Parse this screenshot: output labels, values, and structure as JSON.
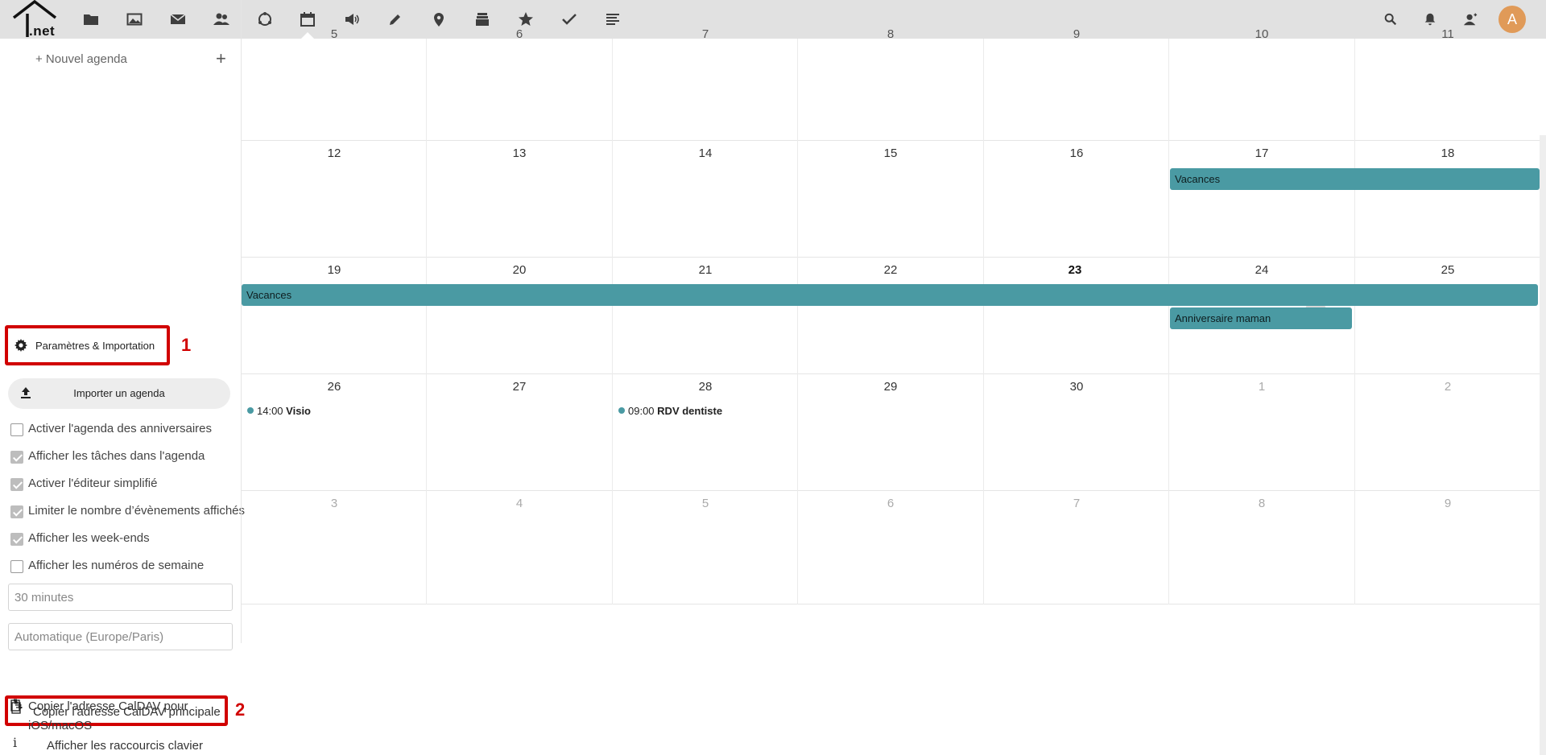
{
  "topbar": {
    "logo_text": ".net",
    "apps": [
      "files-icon",
      "photos-icon",
      "mail-icon",
      "contacts-icon",
      "activity-icon",
      "calendar-icon",
      "announcements-icon",
      "notes-icon",
      "maps-icon",
      "deck-icon",
      "bookmarks-icon",
      "tasks-icon",
      "news-icon"
    ],
    "active_app": "calendar-icon",
    "right_icons": [
      "search-icon",
      "notifications-icon",
      "contacts-menu-icon"
    ],
    "avatar_initial": "A"
  },
  "sidebar": {
    "new_calendar": "+ Nouvel agenda",
    "new_calendar_plus": "+",
    "settings_label": "Paramètres & Importation",
    "import_label": "Importer un agenda",
    "checkboxes": [
      {
        "label": "Activer l'agenda des anniversaires",
        "checked": false
      },
      {
        "label": "Afficher les tâches dans l'agenda",
        "checked": true
      },
      {
        "label": "Activer l'éditeur simplifié",
        "checked": true
      },
      {
        "label": "Limiter le nombre d’évènements affichés",
        "checked": true
      },
      {
        "label": "Afficher les week-ends",
        "checked": true
      },
      {
        "label": "Afficher les numéros de semaine",
        "checked": false
      }
    ],
    "slot_duration": "30 minutes",
    "timezone": "Automatique (Europe/Paris)",
    "copy_main": "Copier l'adresse CalDAV principale",
    "copy_ios_line1": "Copier l'adresse CalDAV pour",
    "copy_ios_line2": "iOS/macOS",
    "keyboard_shortcuts": "Afficher les raccourcis clavier",
    "info_glyph": "i"
  },
  "annotations": {
    "marker_1": "1",
    "marker_2": "2"
  },
  "calendar": {
    "weeks": [
      [
        "5",
        "6",
        "7",
        "8",
        "9",
        "10",
        "11"
      ],
      [
        "12",
        "13",
        "14",
        "15",
        "16",
        "17",
        "18"
      ],
      [
        "19",
        "20",
        "21",
        "22",
        "23",
        "24",
        "25"
      ],
      [
        "26",
        "27",
        "28",
        "29",
        "30",
        "1",
        "2"
      ],
      [
        "3",
        "4",
        "5",
        "6",
        "7",
        "8",
        "9"
      ]
    ],
    "today": "23",
    "events": {
      "vacances_1": "Vacances",
      "vacances_2": "Vacances",
      "anniversaire": "Anniversaire maman",
      "visio_time": "14:00",
      "visio_title": "Visio",
      "dentiste_time": "09:00",
      "dentiste_title": "RDV dentiste"
    },
    "event_color": "#4a9aa3"
  },
  "colors": {
    "topbar_bg": "#e1e1e1",
    "highlight_red": "#d10000",
    "avatar_bg": "#e09a58"
  }
}
